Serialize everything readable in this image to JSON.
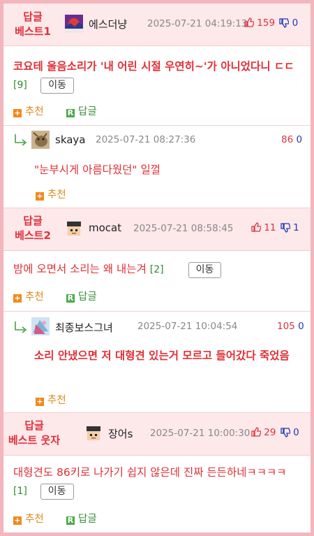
{
  "posts": [
    {
      "badge1": "답글",
      "badge2": "베스트1",
      "nick": "에스더냥",
      "date": "2025-07-21 04:19:13",
      "up": "159",
      "down": "0",
      "title": "코요테 울음소리가 '내 어린 시절 우연히~'가 아니었다니 ㄷㄷ",
      "count": "[9]",
      "move": "이동",
      "recommend": "추천",
      "reply": "답글",
      "sub": {
        "nick": "skaya",
        "date": "2025-07-21 08:27:36",
        "up": "86",
        "down": "0",
        "text": "\"눈부시게 아름다웠던\" 일껄",
        "recommend": "추천"
      }
    },
    {
      "badge1": "답글",
      "badge2": "베스트2",
      "nick": "mocat",
      "date": "2025-07-21 08:58:45",
      "up": "11",
      "down": "1",
      "title": "밤에 오면서 소리는 왜 내는겨",
      "count": "[2]",
      "move": "이동",
      "recommend": "추천",
      "reply": "답글",
      "sub": {
        "nick": "최종보스그녀",
        "date": "2025-07-21 10:04:54",
        "up": "105",
        "down": "0",
        "text": "소리 안냈으면 저 대형견 있는거 모르고 들어갔다 죽었음",
        "recommend": "추천"
      }
    },
    {
      "badge1": "답글",
      "badge2": "베스트 웃자",
      "nick": "장어s",
      "date": "2025-07-21 10:00:30",
      "up": "29",
      "down": "0",
      "title": "대형견도 86키로 나가기 쉽지 않은데 진짜 든든하네ㅋㅋㅋㅋ",
      "count": "[1]",
      "move": "이동",
      "recommend": "추천",
      "reply": "답글"
    }
  ],
  "icons": {
    "recommend": "plus-square-icon",
    "reply": "r-square-icon",
    "thumb_up": "thumb-up-icon",
    "thumb_down": "thumb-down-icon",
    "reply_arrow": "reply-arrow-icon"
  },
  "colors": {
    "background": "#f3b6bd",
    "header": "#fde8ea",
    "accent": "#e0303a",
    "down": "#1d3bb3",
    "recommend": "#f08a1c",
    "reply": "#4caa4c"
  }
}
